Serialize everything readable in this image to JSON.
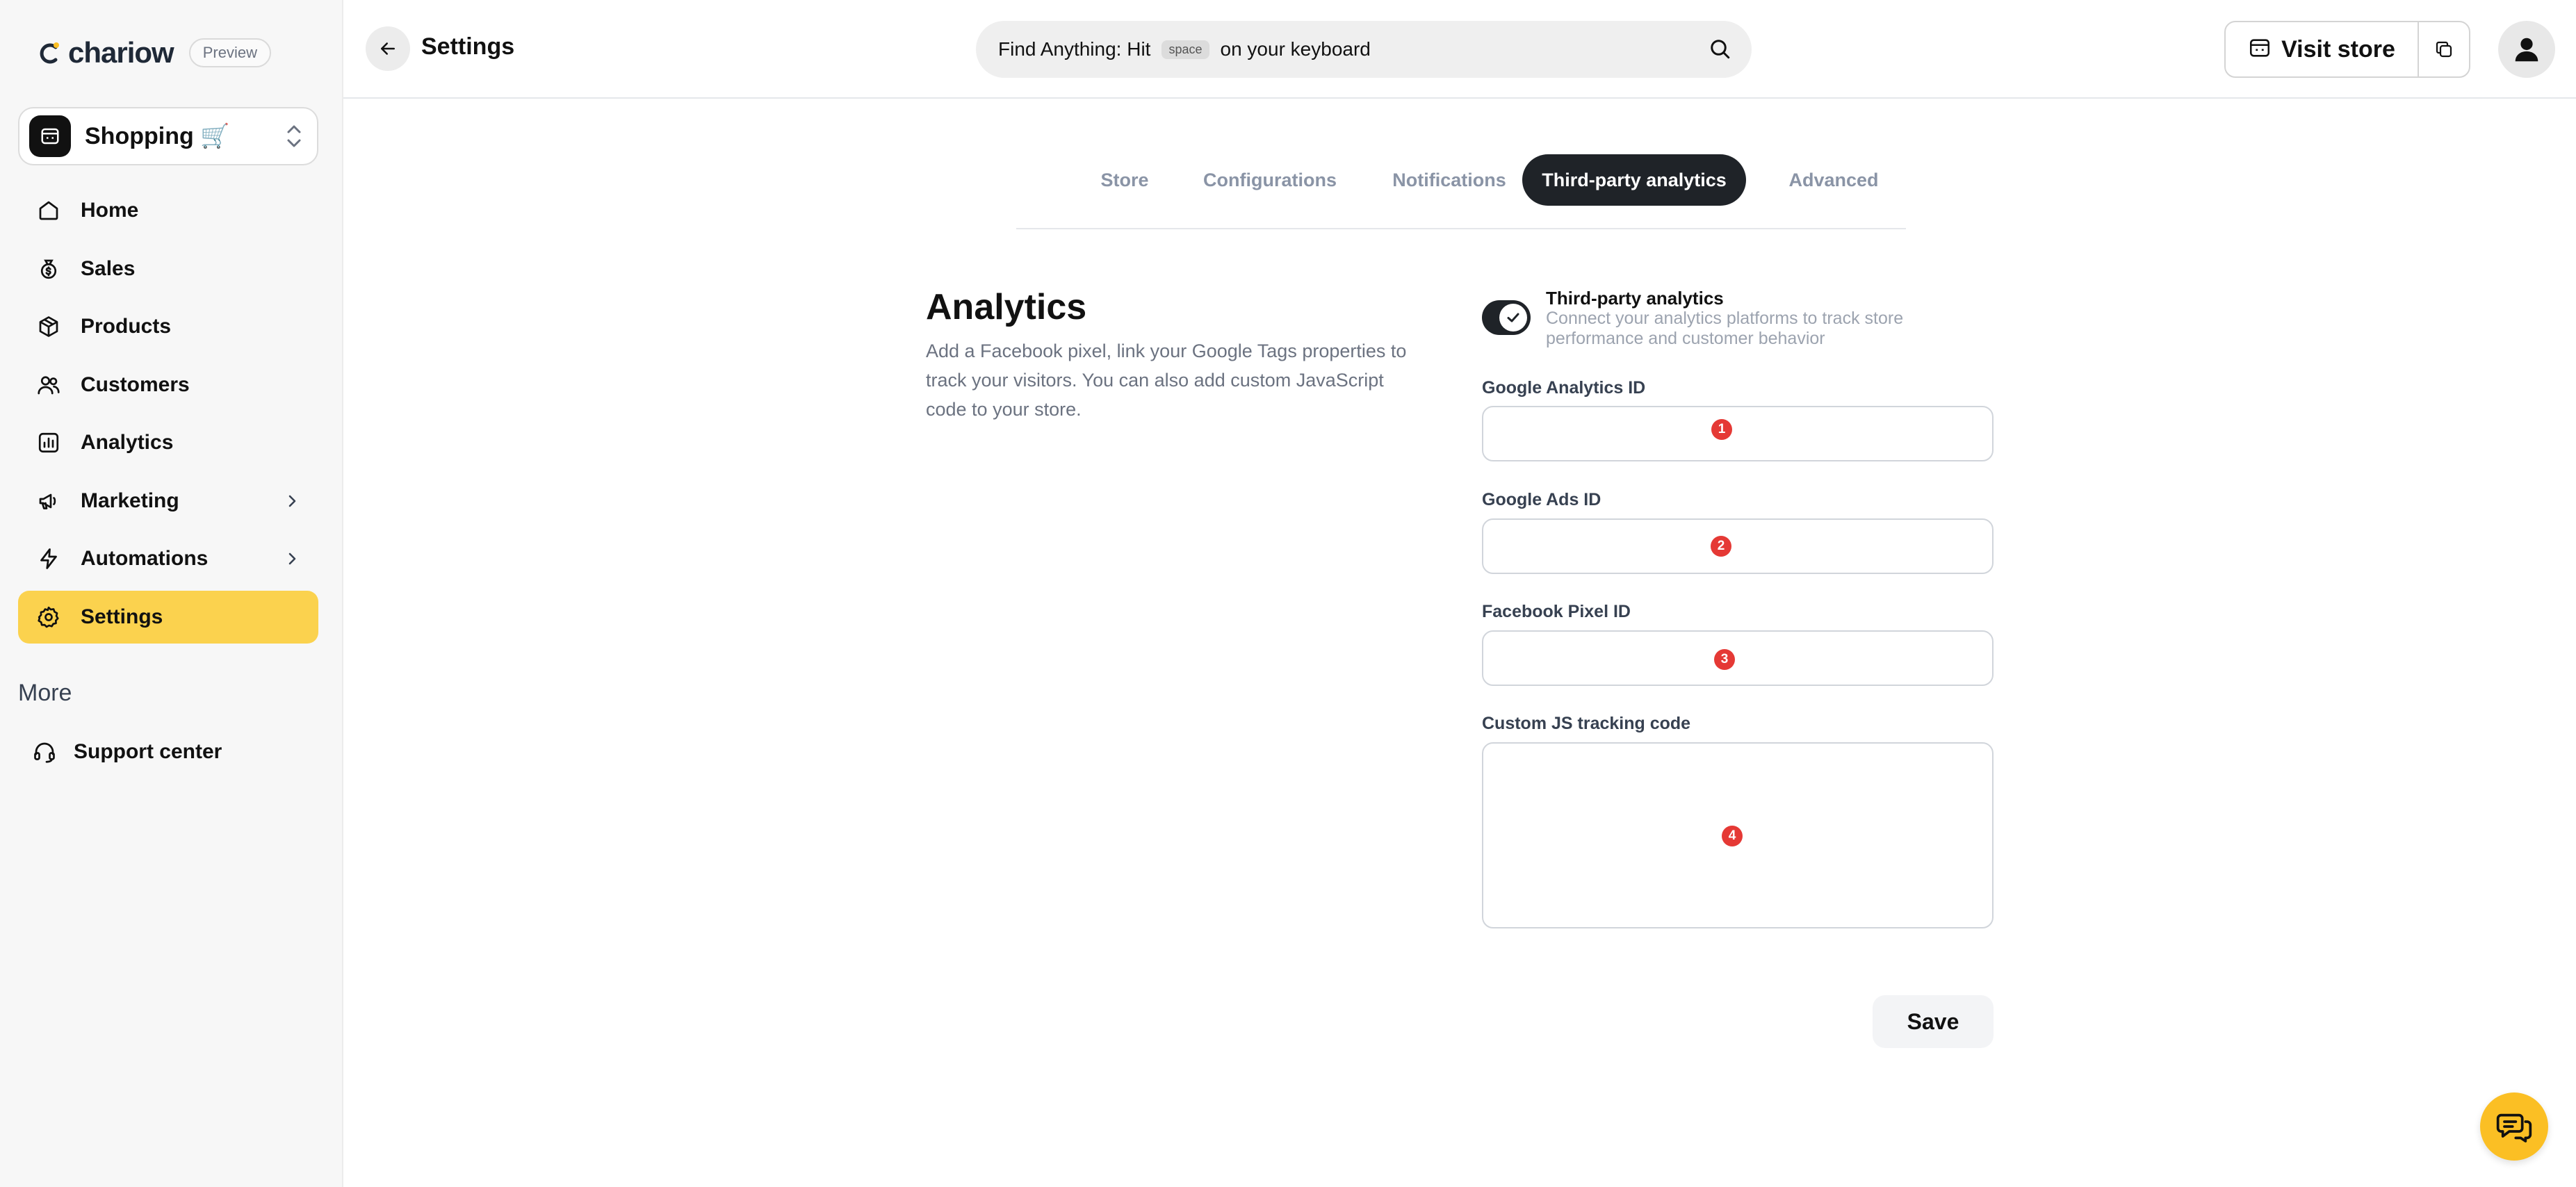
{
  "brand": {
    "name": "chariow",
    "badge": "Preview",
    "accent": "#fbd24e"
  },
  "store": {
    "name": "Shopping 🛒"
  },
  "nav": {
    "items": [
      {
        "label": "Home",
        "icon": "home-icon"
      },
      {
        "label": "Sales",
        "icon": "money-bag-icon"
      },
      {
        "label": "Products",
        "icon": "box-icon"
      },
      {
        "label": "Customers",
        "icon": "users-icon"
      },
      {
        "label": "Analytics",
        "icon": "bar-chart-icon"
      },
      {
        "label": "Marketing",
        "icon": "megaphone-icon"
      },
      {
        "label": "Automations",
        "icon": "lightning-icon"
      },
      {
        "label": "Settings",
        "icon": "gear-icon"
      }
    ],
    "active": "Settings",
    "more_label": "More",
    "support_label": "Support center"
  },
  "header": {
    "title": "Settings",
    "search": {
      "prefix": "Find Anything: Hit",
      "key": "space",
      "suffix": "on your keyboard"
    },
    "visit_store_label": "Visit store"
  },
  "tabs": [
    {
      "label": "Store",
      "active": false
    },
    {
      "label": "Configurations",
      "active": false
    },
    {
      "label": "Notifications",
      "active": false
    },
    {
      "label": "Third-party analytics",
      "active": true
    },
    {
      "label": "Advanced",
      "active": false
    }
  ],
  "section": {
    "title": "Analytics",
    "description": "Add a Facebook pixel, link your Google Tags properties to track your visitors. You can also add custom JavaScript code to your store."
  },
  "toggle": {
    "title": "Third-party analytics",
    "description": "Connect your analytics platforms to track store performance and customer behavior",
    "enabled": true
  },
  "fields": {
    "google_analytics": {
      "label": "Google Analytics ID",
      "value": "",
      "marker": "1"
    },
    "google_ads": {
      "label": "Google Ads ID",
      "value": "",
      "marker": "2"
    },
    "facebook_pixel": {
      "label": "Facebook Pixel ID",
      "value": "",
      "marker": "3"
    },
    "custom_js": {
      "label": "Custom JS tracking code",
      "value": "",
      "marker": "4"
    }
  },
  "save_label": "Save"
}
